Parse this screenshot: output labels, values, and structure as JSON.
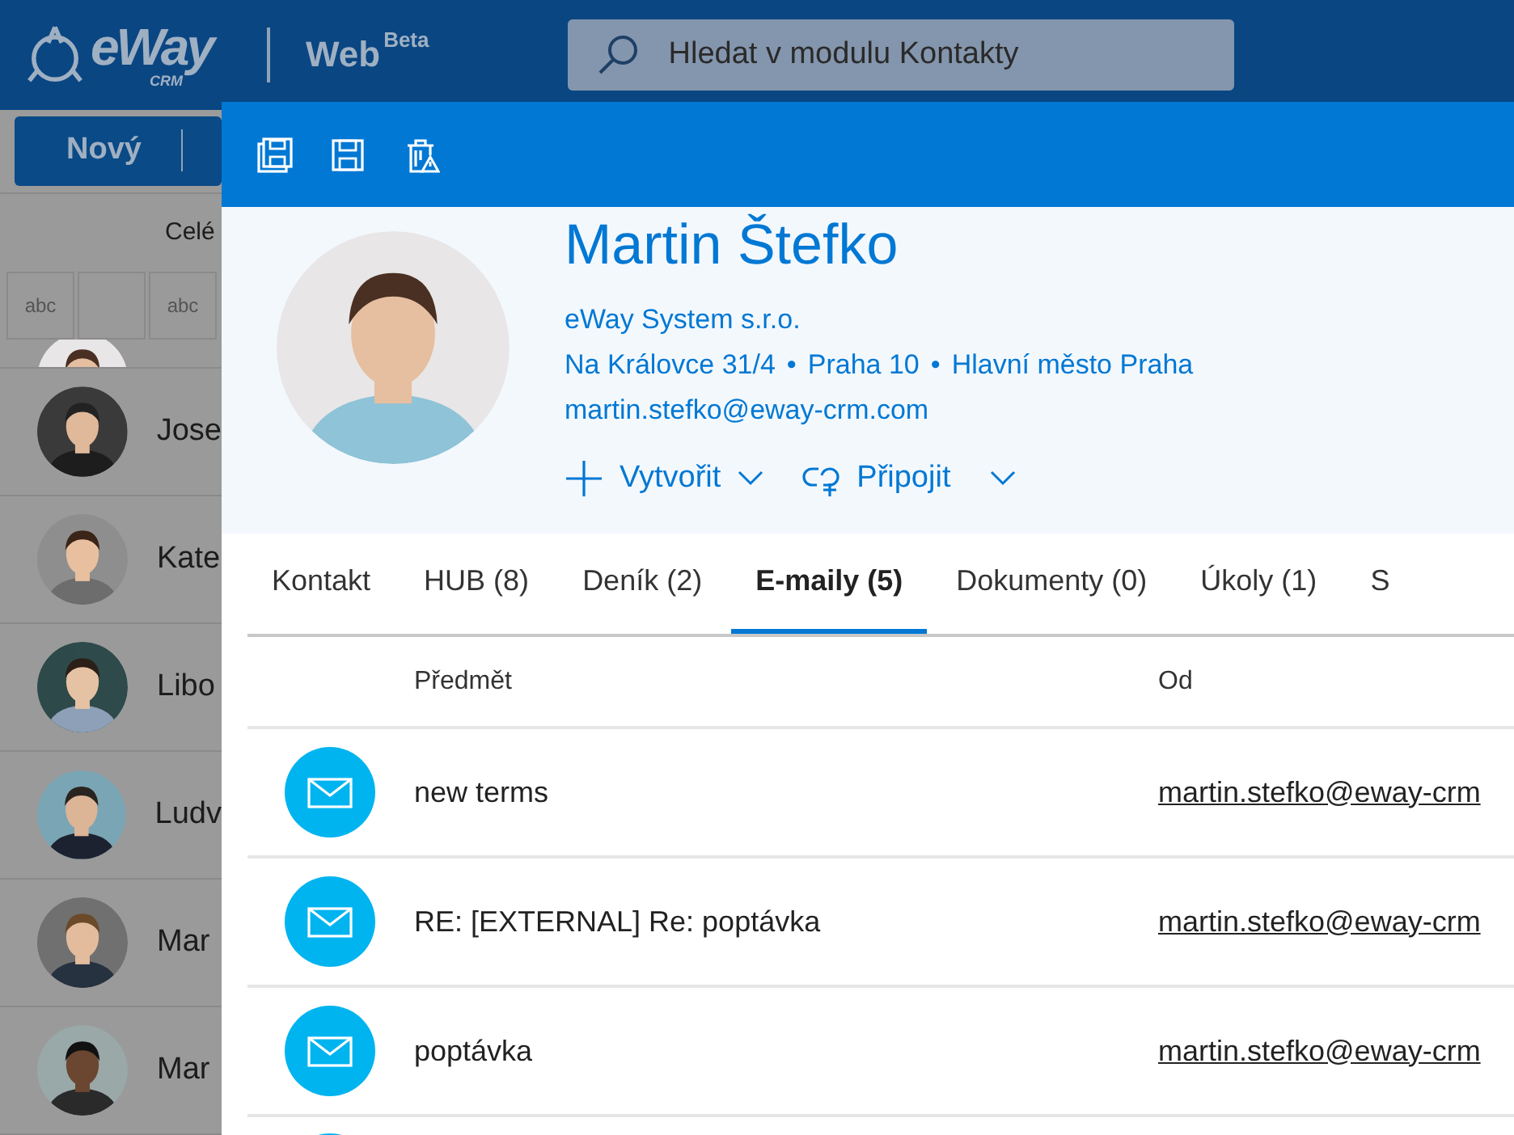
{
  "app_header": {
    "logo": "eWay",
    "logo_sub": "CRM",
    "product": "Web",
    "product_badge": "Beta",
    "search": {
      "placeholder": "Hledat v modulu Kontakty"
    }
  },
  "list_panel": {
    "new_button": "Nový",
    "view_label": "Celé",
    "filter_cells": [
      {
        "kind": "text",
        "label": "abc"
      },
      {
        "kind": "empty"
      },
      {
        "kind": "text",
        "label": "abc"
      }
    ],
    "contacts": [
      {
        "name": "Jose"
      },
      {
        "name": "Kate"
      },
      {
        "name": "Libo"
      },
      {
        "name": "Ludv"
      },
      {
        "name": "Mar"
      },
      {
        "name": "Mar"
      }
    ]
  },
  "dialog": {
    "toolbar": [
      {
        "kind": "save-copy"
      },
      {
        "kind": "save"
      },
      {
        "kind": "delete"
      }
    ],
    "contact": {
      "name": "Martin Štefko",
      "company": "eWay System s.r.o.",
      "address": [
        "Na Královce 31/4",
        "Praha 10",
        "Hlavní město Praha"
      ],
      "separator": "•",
      "email": "martin.stefko@eway-crm.com"
    },
    "actions": [
      {
        "kind": "create",
        "label": "Vytvořit"
      },
      {
        "kind": "connect",
        "label": "Připojit"
      }
    ],
    "tabs": [
      {
        "label": "Kontakt",
        "selected": false
      },
      {
        "label": "HUB (8)",
        "selected": false
      },
      {
        "label": "Deník (2)",
        "selected": false
      },
      {
        "label": "E-maily (5)",
        "selected": true
      },
      {
        "label": "Dokumenty (0)",
        "selected": false
      },
      {
        "label": "Úkoly (1)",
        "selected": false
      },
      {
        "label": "S",
        "selected": false
      }
    ],
    "table": {
      "columns": [
        "Předmět",
        "Od"
      ],
      "rows": [
        {
          "kind": "email",
          "subject": "new terms",
          "from": "martin.stefko@eway-crm"
        },
        {
          "kind": "email",
          "subject": "RE: [EXTERNAL] Re: poptávka",
          "from": "martin.stefko@eway-crm"
        },
        {
          "kind": "email",
          "subject": "poptávka",
          "from": "martin.stefko@eway-crm"
        },
        {
          "kind": "cut"
        }
      ]
    }
  }
}
